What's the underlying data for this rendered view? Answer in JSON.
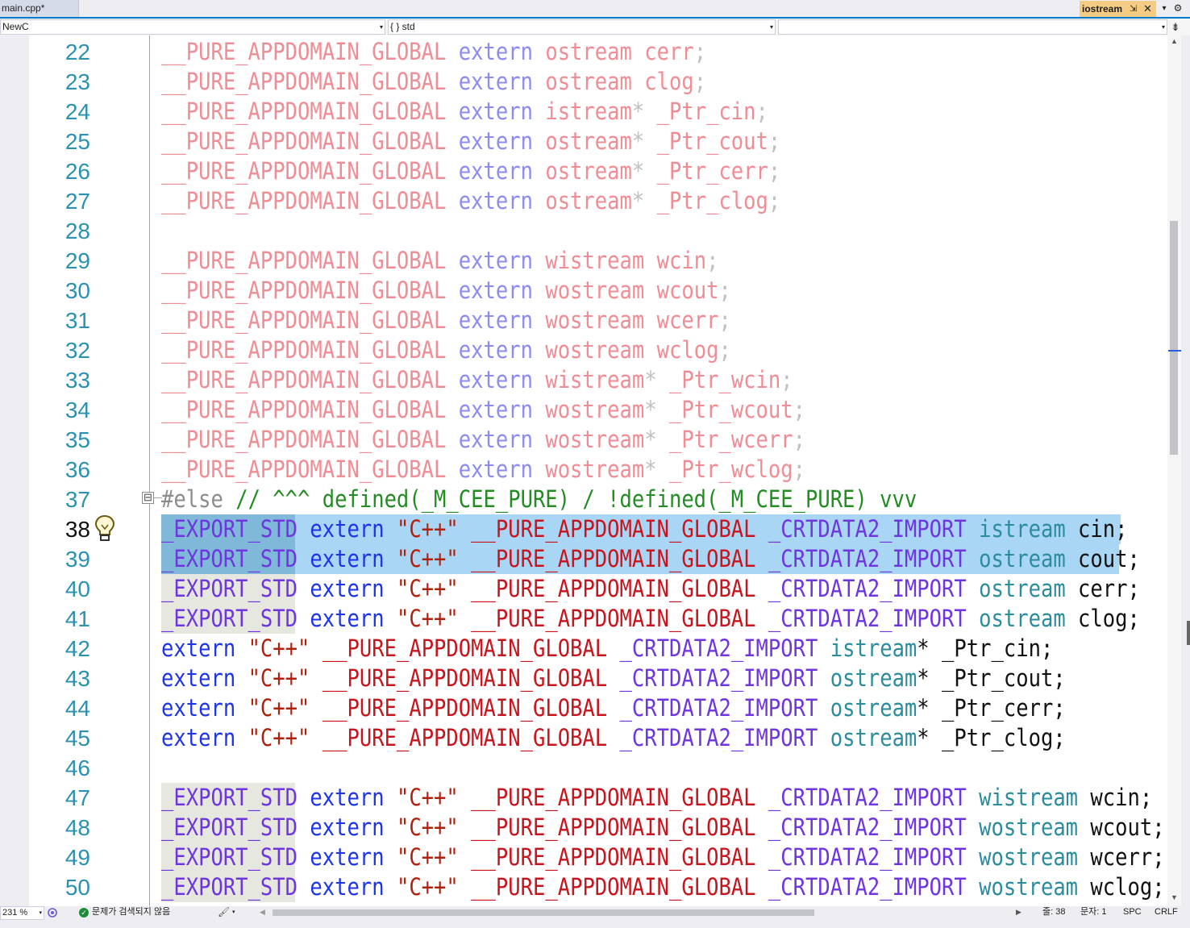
{
  "tabs": {
    "main": {
      "label": "main.cpp*"
    },
    "iostream": {
      "label": "iostream",
      "pin": "⇲",
      "close": "✕"
    },
    "dropdown": "▾",
    "gear": "⚙"
  },
  "navbar": {
    "project": "NewC",
    "scope": "{ } std",
    "member": "",
    "split": "⇟"
  },
  "editor": {
    "current_line": 38,
    "lines": [
      {
        "n": "22",
        "tokens": [
          [
            "__PURE_APPDOMAIN_GLOBAL",
            "md"
          ],
          [
            " ",
            "x"
          ],
          [
            "extern",
            "kd"
          ],
          [
            " ",
            "x"
          ],
          [
            "ostream",
            "md"
          ],
          [
            " ",
            "x"
          ],
          [
            "cerr",
            "md"
          ],
          [
            ";",
            "xd"
          ]
        ]
      },
      {
        "n": "23",
        "tokens": [
          [
            "__PURE_APPDOMAIN_GLOBAL",
            "md"
          ],
          [
            " ",
            "x"
          ],
          [
            "extern",
            "kd"
          ],
          [
            " ",
            "x"
          ],
          [
            "ostream",
            "md"
          ],
          [
            " ",
            "x"
          ],
          [
            "clog",
            "md"
          ],
          [
            ";",
            "xd"
          ]
        ]
      },
      {
        "n": "24",
        "tokens": [
          [
            "__PURE_APPDOMAIN_GLOBAL",
            "md"
          ],
          [
            " ",
            "x"
          ],
          [
            "extern",
            "kd"
          ],
          [
            " ",
            "x"
          ],
          [
            "istream",
            "md"
          ],
          [
            "*",
            "xd"
          ],
          [
            " ",
            "x"
          ],
          [
            "_Ptr_cin",
            "md"
          ],
          [
            ";",
            "xd"
          ]
        ]
      },
      {
        "n": "25",
        "tokens": [
          [
            "__PURE_APPDOMAIN_GLOBAL",
            "md"
          ],
          [
            " ",
            "x"
          ],
          [
            "extern",
            "kd"
          ],
          [
            " ",
            "x"
          ],
          [
            "ostream",
            "md"
          ],
          [
            "*",
            "xd"
          ],
          [
            " ",
            "x"
          ],
          [
            "_Ptr_cout",
            "md"
          ],
          [
            ";",
            "xd"
          ]
        ]
      },
      {
        "n": "26",
        "tokens": [
          [
            "__PURE_APPDOMAIN_GLOBAL",
            "md"
          ],
          [
            " ",
            "x"
          ],
          [
            "extern",
            "kd"
          ],
          [
            " ",
            "x"
          ],
          [
            "ostream",
            "md"
          ],
          [
            "*",
            "xd"
          ],
          [
            " ",
            "x"
          ],
          [
            "_Ptr_cerr",
            "md"
          ],
          [
            ";",
            "xd"
          ]
        ]
      },
      {
        "n": "27",
        "tokens": [
          [
            "__PURE_APPDOMAIN_GLOBAL",
            "md"
          ],
          [
            " ",
            "x"
          ],
          [
            "extern",
            "kd"
          ],
          [
            " ",
            "x"
          ],
          [
            "ostream",
            "md"
          ],
          [
            "*",
            "xd"
          ],
          [
            " ",
            "x"
          ],
          [
            "_Ptr_clog",
            "md"
          ],
          [
            ";",
            "xd"
          ]
        ]
      },
      {
        "n": "28",
        "tokens": []
      },
      {
        "n": "29",
        "tokens": [
          [
            "__PURE_APPDOMAIN_GLOBAL",
            "md"
          ],
          [
            " ",
            "x"
          ],
          [
            "extern",
            "kd"
          ],
          [
            " ",
            "x"
          ],
          [
            "wistream",
            "md"
          ],
          [
            " ",
            "x"
          ],
          [
            "wcin",
            "md"
          ],
          [
            ";",
            "xd"
          ]
        ]
      },
      {
        "n": "30",
        "tokens": [
          [
            "__PURE_APPDOMAIN_GLOBAL",
            "md"
          ],
          [
            " ",
            "x"
          ],
          [
            "extern",
            "kd"
          ],
          [
            " ",
            "x"
          ],
          [
            "wostream",
            "md"
          ],
          [
            " ",
            "x"
          ],
          [
            "wcout",
            "md"
          ],
          [
            ";",
            "xd"
          ]
        ]
      },
      {
        "n": "31",
        "tokens": [
          [
            "__PURE_APPDOMAIN_GLOBAL",
            "md"
          ],
          [
            " ",
            "x"
          ],
          [
            "extern",
            "kd"
          ],
          [
            " ",
            "x"
          ],
          [
            "wostream",
            "md"
          ],
          [
            " ",
            "x"
          ],
          [
            "wcerr",
            "md"
          ],
          [
            ";",
            "xd"
          ]
        ]
      },
      {
        "n": "32",
        "tokens": [
          [
            "__PURE_APPDOMAIN_GLOBAL",
            "md"
          ],
          [
            " ",
            "x"
          ],
          [
            "extern",
            "kd"
          ],
          [
            " ",
            "x"
          ],
          [
            "wostream",
            "md"
          ],
          [
            " ",
            "x"
          ],
          [
            "wclog",
            "md"
          ],
          [
            ";",
            "xd"
          ]
        ]
      },
      {
        "n": "33",
        "tokens": [
          [
            "__PURE_APPDOMAIN_GLOBAL",
            "md"
          ],
          [
            " ",
            "x"
          ],
          [
            "extern",
            "kd"
          ],
          [
            " ",
            "x"
          ],
          [
            "wistream",
            "md"
          ],
          [
            "*",
            "xd"
          ],
          [
            " ",
            "x"
          ],
          [
            "_Ptr_wcin",
            "md"
          ],
          [
            ";",
            "xd"
          ]
        ]
      },
      {
        "n": "34",
        "tokens": [
          [
            "__PURE_APPDOMAIN_GLOBAL",
            "md"
          ],
          [
            " ",
            "x"
          ],
          [
            "extern",
            "kd"
          ],
          [
            " ",
            "x"
          ],
          [
            "wostream",
            "md"
          ],
          [
            "*",
            "xd"
          ],
          [
            " ",
            "x"
          ],
          [
            "_Ptr_wcout",
            "md"
          ],
          [
            ";",
            "xd"
          ]
        ]
      },
      {
        "n": "35",
        "tokens": [
          [
            "__PURE_APPDOMAIN_GLOBAL",
            "md"
          ],
          [
            " ",
            "x"
          ],
          [
            "extern",
            "kd"
          ],
          [
            " ",
            "x"
          ],
          [
            "wostream",
            "md"
          ],
          [
            "*",
            "xd"
          ],
          [
            " ",
            "x"
          ],
          [
            "_Ptr_wcerr",
            "md"
          ],
          [
            ";",
            "xd"
          ]
        ]
      },
      {
        "n": "36",
        "tokens": [
          [
            "__PURE_APPDOMAIN_GLOBAL",
            "md"
          ],
          [
            " ",
            "x"
          ],
          [
            "extern",
            "kd"
          ],
          [
            " ",
            "x"
          ],
          [
            "wostream",
            "md"
          ],
          [
            "*",
            "xd"
          ],
          [
            " ",
            "x"
          ],
          [
            "_Ptr_wclog",
            "md"
          ],
          [
            ";",
            "xd"
          ]
        ]
      },
      {
        "n": "37",
        "tokens": [
          [
            "#else",
            "g"
          ],
          [
            " // ^^^ defined(_M_CEE_PURE) / !defined(_M_CEE_PURE) vvv",
            "c"
          ]
        ]
      },
      {
        "n": "38",
        "sel": true,
        "exp": true,
        "tokens": [
          [
            "_EXPORT_STD",
            "p"
          ],
          [
            " ",
            "x"
          ],
          [
            "extern",
            "k"
          ],
          [
            " ",
            "x"
          ],
          [
            "\"C++\"",
            "s"
          ],
          [
            " ",
            "x"
          ],
          [
            "__PURE_APPDOMAIN_GLOBAL",
            "m"
          ],
          [
            " ",
            "x"
          ],
          [
            "_CRTDATA2_IMPORT",
            "p"
          ],
          [
            " ",
            "x"
          ],
          [
            "istream",
            "t"
          ],
          [
            " cin;",
            "x"
          ]
        ]
      },
      {
        "n": "39",
        "sel": true,
        "exp": true,
        "tokens": [
          [
            "_EXPORT_STD",
            "p"
          ],
          [
            " ",
            "x"
          ],
          [
            "extern",
            "k"
          ],
          [
            " ",
            "x"
          ],
          [
            "\"C++\"",
            "s"
          ],
          [
            " ",
            "x"
          ],
          [
            "__PURE_APPDOMAIN_GLOBAL",
            "m"
          ],
          [
            " ",
            "x"
          ],
          [
            "_CRTDATA2_IMPORT",
            "p"
          ],
          [
            " ",
            "x"
          ],
          [
            "ostream",
            "t"
          ],
          [
            " cout;",
            "x"
          ]
        ]
      },
      {
        "n": "40",
        "exp": true,
        "tokens": [
          [
            "_EXPORT_STD",
            "p"
          ],
          [
            " ",
            "x"
          ],
          [
            "extern",
            "k"
          ],
          [
            " ",
            "x"
          ],
          [
            "\"C++\"",
            "s"
          ],
          [
            " ",
            "x"
          ],
          [
            "__PURE_APPDOMAIN_GLOBAL",
            "m"
          ],
          [
            " ",
            "x"
          ],
          [
            "_CRTDATA2_IMPORT",
            "p"
          ],
          [
            " ",
            "x"
          ],
          [
            "ostream",
            "t"
          ],
          [
            " cerr;",
            "x"
          ]
        ]
      },
      {
        "n": "41",
        "exp": true,
        "tokens": [
          [
            "_EXPORT_STD",
            "p"
          ],
          [
            " ",
            "x"
          ],
          [
            "extern",
            "k"
          ],
          [
            " ",
            "x"
          ],
          [
            "\"C++\"",
            "s"
          ],
          [
            " ",
            "x"
          ],
          [
            "__PURE_APPDOMAIN_GLOBAL",
            "m"
          ],
          [
            " ",
            "x"
          ],
          [
            "_CRTDATA2_IMPORT",
            "p"
          ],
          [
            " ",
            "x"
          ],
          [
            "ostream",
            "t"
          ],
          [
            " clog;",
            "x"
          ]
        ]
      },
      {
        "n": "42",
        "tokens": [
          [
            "extern",
            "k"
          ],
          [
            " ",
            "x"
          ],
          [
            "\"C++\"",
            "s"
          ],
          [
            " ",
            "x"
          ],
          [
            "__PURE_APPDOMAIN_GLOBAL",
            "m"
          ],
          [
            " ",
            "x"
          ],
          [
            "_CRTDATA2_IMPORT",
            "p"
          ],
          [
            " ",
            "x"
          ],
          [
            "istream",
            "t"
          ],
          [
            "* _Ptr_cin;",
            "x"
          ]
        ]
      },
      {
        "n": "43",
        "tokens": [
          [
            "extern",
            "k"
          ],
          [
            " ",
            "x"
          ],
          [
            "\"C++\"",
            "s"
          ],
          [
            " ",
            "x"
          ],
          [
            "__PURE_APPDOMAIN_GLOBAL",
            "m"
          ],
          [
            " ",
            "x"
          ],
          [
            "_CRTDATA2_IMPORT",
            "p"
          ],
          [
            " ",
            "x"
          ],
          [
            "ostream",
            "t"
          ],
          [
            "* _Ptr_cout;",
            "x"
          ]
        ]
      },
      {
        "n": "44",
        "tokens": [
          [
            "extern",
            "k"
          ],
          [
            " ",
            "x"
          ],
          [
            "\"C++\"",
            "s"
          ],
          [
            " ",
            "x"
          ],
          [
            "__PURE_APPDOMAIN_GLOBAL",
            "m"
          ],
          [
            " ",
            "x"
          ],
          [
            "_CRTDATA2_IMPORT",
            "p"
          ],
          [
            " ",
            "x"
          ],
          [
            "ostream",
            "t"
          ],
          [
            "* _Ptr_cerr;",
            "x"
          ]
        ]
      },
      {
        "n": "45",
        "tokens": [
          [
            "extern",
            "k"
          ],
          [
            " ",
            "x"
          ],
          [
            "\"C++\"",
            "s"
          ],
          [
            " ",
            "x"
          ],
          [
            "__PURE_APPDOMAIN_GLOBAL",
            "m"
          ],
          [
            " ",
            "x"
          ],
          [
            "_CRTDATA2_IMPORT",
            "p"
          ],
          [
            " ",
            "x"
          ],
          [
            "ostream",
            "t"
          ],
          [
            "* _Ptr_clog;",
            "x"
          ]
        ]
      },
      {
        "n": "46",
        "tokens": []
      },
      {
        "n": "47",
        "exp": true,
        "tokens": [
          [
            "_EXPORT_STD",
            "p"
          ],
          [
            " ",
            "x"
          ],
          [
            "extern",
            "k"
          ],
          [
            " ",
            "x"
          ],
          [
            "\"C++\"",
            "s"
          ],
          [
            " ",
            "x"
          ],
          [
            "__PURE_APPDOMAIN_GLOBAL",
            "m"
          ],
          [
            " ",
            "x"
          ],
          [
            "_CRTDATA2_IMPORT",
            "p"
          ],
          [
            " ",
            "x"
          ],
          [
            "wistream",
            "t"
          ],
          [
            " wcin;",
            "x"
          ]
        ]
      },
      {
        "n": "48",
        "exp": true,
        "tokens": [
          [
            "_EXPORT_STD",
            "p"
          ],
          [
            " ",
            "x"
          ],
          [
            "extern",
            "k"
          ],
          [
            " ",
            "x"
          ],
          [
            "\"C++\"",
            "s"
          ],
          [
            " ",
            "x"
          ],
          [
            "__PURE_APPDOMAIN_GLOBAL",
            "m"
          ],
          [
            " ",
            "x"
          ],
          [
            "_CRTDATA2_IMPORT",
            "p"
          ],
          [
            " ",
            "x"
          ],
          [
            "wostream",
            "t"
          ],
          [
            " wcout;",
            "x"
          ]
        ]
      },
      {
        "n": "49",
        "exp": true,
        "tokens": [
          [
            "_EXPORT_STD",
            "p"
          ],
          [
            " ",
            "x"
          ],
          [
            "extern",
            "k"
          ],
          [
            " ",
            "x"
          ],
          [
            "\"C++\"",
            "s"
          ],
          [
            " ",
            "x"
          ],
          [
            "__PURE_APPDOMAIN_GLOBAL",
            "m"
          ],
          [
            " ",
            "x"
          ],
          [
            "_CRTDATA2_IMPORT",
            "p"
          ],
          [
            " ",
            "x"
          ],
          [
            "wostream",
            "t"
          ],
          [
            " wcerr;",
            "x"
          ]
        ]
      },
      {
        "n": "50",
        "exp": true,
        "tokens": [
          [
            "_EXPORT_STD",
            "p"
          ],
          [
            " ",
            "x"
          ],
          [
            "extern",
            "k"
          ],
          [
            " ",
            "x"
          ],
          [
            "\"C++\"",
            "s"
          ],
          [
            " ",
            "x"
          ],
          [
            "__PURE_APPDOMAIN_GLOBAL",
            "m"
          ],
          [
            " ",
            "x"
          ],
          [
            "_CRTDATA2_IMPORT",
            "p"
          ],
          [
            " ",
            "x"
          ],
          [
            "wostream",
            "t"
          ],
          [
            " wclog;",
            "x"
          ]
        ]
      }
    ]
  },
  "icons": {
    "lightbulb": "lightbulb-icon",
    "collapse": "⊟",
    "scroll_up": "▲",
    "scroll_down": "▼",
    "scroll_left": "◀",
    "scroll_right": "▶",
    "brush": "🖌",
    "arrow": "▾",
    "check": "✓"
  },
  "status": {
    "zoom": "231 %",
    "issues": "문제가 검색되지 않음",
    "line": "줄: 38",
    "col": "문자: 1",
    "spc": "SPC",
    "crlf": "CRLF"
  },
  "colors": {
    "accent": "#007acc",
    "active_tab": "#f5cc84",
    "selection": "#aad6f5",
    "macro": "#c8141c",
    "keyword": "#1d34e8",
    "type": "#2b8c9c",
    "comment": "#238c23"
  }
}
